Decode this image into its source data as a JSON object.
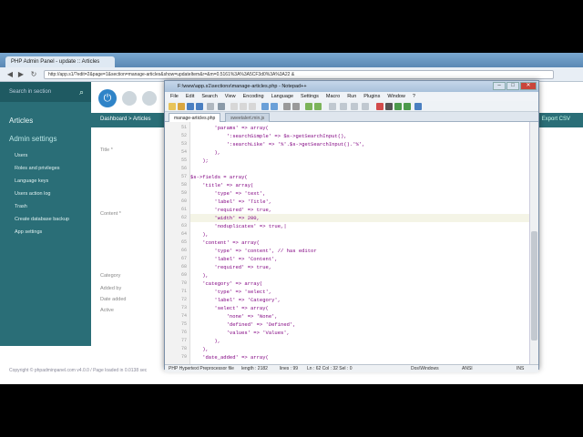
{
  "browser": {
    "tab_title": "PHP Admin Panel - update :: Articles",
    "url": "http://app.s1/?edit=2&page=1&section=manage-articles&show=updateItem&r=&m=0.5161%3A%3A5CF3d0%3A%3A22 &"
  },
  "admin": {
    "search_placeholder": "Search in section",
    "section_articles": "Articles",
    "section_admin": "Admin settings",
    "links": [
      "Users",
      "Roles and privileges",
      "Language keys",
      "Users action log",
      "Trash",
      "Create database backup",
      "App settings"
    ],
    "breadcrumb": "Dashboard > Articles",
    "labels": {
      "title": "Title *",
      "content": "Content *",
      "category": "Category",
      "added_by": "Added by",
      "date_added": "Date added",
      "active": "Active"
    },
    "right_button": "Export CSV",
    "footer": "Copyright © phpadminpanel.com v4.0.0 / Page loaded in 0.0138 sec"
  },
  "editor": {
    "title": "F:\\www\\app.s1\\sections\\manage-articles.php - Notepad++",
    "menu": [
      "File",
      "Edit",
      "Search",
      "View",
      "Encoding",
      "Language",
      "Settings",
      "Macro",
      "Run",
      "Plugins",
      "Window",
      "?"
    ],
    "tabs": [
      "manage-articles.php",
      "sweetalert.min.js"
    ],
    "first_line": 51,
    "highlight_line": 62,
    "code": [
      "        'params' => array(",
      "            ':searchSimple' => $s->getSearchInput(),",
      "            ':searchLike' => '%'.$s->getSearchInput().'%',",
      "        ),",
      "    );",
      "",
      "$s->fields = array(",
      "    'title' => array(",
      "        'type' => 'text',",
      "        'label' => 'Title',",
      "        'required' => true,",
      "        'width' => 200,",
      "        'noduplicates' => true,|",
      "    ),",
      "    'content' => array(",
      "        'type' => 'content', // has editor",
      "        'label' => 'Content',",
      "        'required' => true,",
      "    ),",
      "    'category' => array(",
      "        'type' => 'select',",
      "        'label' => 'Category',",
      "        'select' => array(",
      "            'none' => 'None',",
      "            'defined' => 'Defined',",
      "            'values' => 'Values',",
      "        ),",
      "    ),",
      "    'date_added' => array("
    ],
    "status": {
      "filetype": "PHP Hypertext Preprocessor file",
      "length": "length : 2182",
      "lines": "lines : 99",
      "position": "Ln : 62    Col : 32    Sel : 0",
      "eol": "Dos\\Windows",
      "encoding": "ANSI",
      "mode": "INS"
    }
  }
}
